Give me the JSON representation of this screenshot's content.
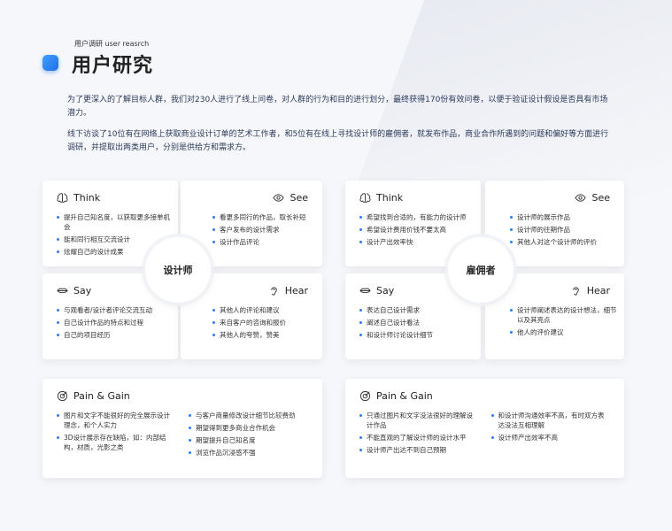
{
  "header": {
    "subtitle": "用户调研 user reasrch",
    "title": "用户研究"
  },
  "intro": {
    "p1": "为了更深入的了解目标人群，我们对230人进行了线上问卷，对人群的行为和目的进行划分，最终获得170份有效问卷，以便于验证设计假设是否具有市场潜力。",
    "p2": "线下访谈了10位有在网络上获取商业设计订单的艺术工作者，和5位有在线上寻找设计师的雇佣者，就发布作品，商业合作所遇到的问题和偏好等方面进行调研，并提取出两类用户，分别是供给方和需求方。"
  },
  "designer": {
    "center": "设计师",
    "think": {
      "title": "Think",
      "items": [
        "提升自己知名度，以获取更多接单机会",
        "能和同行相互交流设计",
        "炫耀自己的设计成果"
      ]
    },
    "see": {
      "title": "See",
      "items": [
        "看更多同行的作品，取长补短",
        "客户发布的设计需求",
        "设计作品评论"
      ]
    },
    "say": {
      "title": "Say",
      "items": [
        "与观看者/设计者评论交流互动",
        "自己设计作品的特点和过程",
        "自己的项目经历"
      ]
    },
    "hear": {
      "title": "Hear",
      "items": [
        "其他人的评论和建议",
        "来自客户的咨询和报价",
        "其他人的夸赞，赞美"
      ]
    },
    "gain": {
      "title": "Pain & Gain",
      "col1": [
        "图片和文字不能很好的完全展示设计理念，和个人实力",
        "3D设计展示存在缺陷，如：内部结构，材质，光影之类"
      ],
      "col2": [
        "与客户商量修改设计细节比较费劲",
        "期望得到更多商业合作机会",
        "期望提升自己知名度",
        "浏览作品沉浸感不强"
      ]
    }
  },
  "employer": {
    "center": "雇佣者",
    "think": {
      "title": "Think",
      "items": [
        "希望找到合适的，有能力的设计师",
        "希望设计费用价钱不要太高",
        "设计产出效率快"
      ]
    },
    "see": {
      "title": "See",
      "items": [
        "设计师的展示作品",
        "设计师的往期作品",
        "其他人对这个设计师的评价"
      ]
    },
    "say": {
      "title": "Say",
      "items": [
        "表达自己设计需求",
        "阐述自己设计看法",
        "和设计师讨论设计细节"
      ]
    },
    "hear": {
      "title": "Hear",
      "items": [
        "设计师阐述表达的设计想法，细节以及其亮点",
        "他人的评价建议"
      ]
    },
    "gain": {
      "title": "Pain & Gain",
      "col1": [
        "只通过图片和文字没法很好的理解设计作品",
        "不能直观的了解设计师的设计水平",
        "设计师产出达不到自己预期"
      ],
      "col2": [
        "和设计师沟通效率不高，有时双方表达没法互相理解",
        "设计师产出效率不高"
      ]
    }
  },
  "colors": {
    "accent": "#2f7bf5",
    "text": "#2b3a5a"
  }
}
